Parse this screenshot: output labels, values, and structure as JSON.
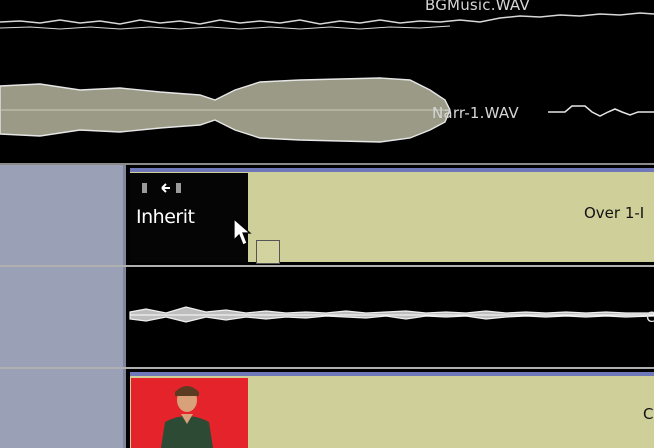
{
  "timeline": {
    "audio_clips": {
      "background_music": "BGMusic.WAV",
      "narration": "Narr-1.WAV"
    },
    "transition": {
      "label": "Inherit",
      "icon": "transition-direction-icon"
    },
    "overlay_clip": {
      "label": "Over 1-I"
    },
    "overlay_audio": {
      "label": "C"
    },
    "video_clip": {
      "label": "C",
      "thumbnail_icon": "person-thumbnail"
    }
  },
  "colors": {
    "timeline_background": "#000000",
    "track_header": "#9aa0b5",
    "clip_fill": "#cfcf9a",
    "clip_top_strip": "#6e78b8",
    "waveform_narration": "#9a9a86",
    "video_thumb_background": "#e4242a"
  }
}
